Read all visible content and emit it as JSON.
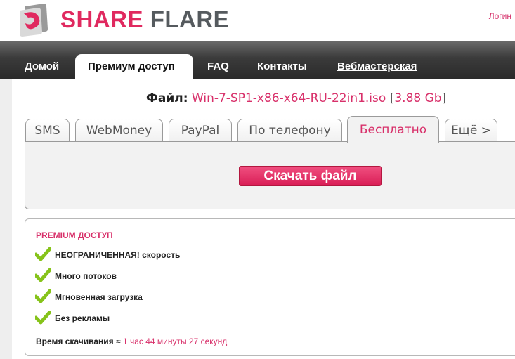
{
  "header": {
    "logo_share": "SHARE",
    "logo_flare": "FLARE",
    "login_label": "Логин"
  },
  "nav": {
    "items": [
      {
        "label": "Домой"
      },
      {
        "label": "Премиум доступ",
        "active": true
      },
      {
        "label": "FAQ"
      },
      {
        "label": "Контакты"
      },
      {
        "label": "Вебмастерская"
      }
    ]
  },
  "file": {
    "label": "Файл:",
    "name": "Win-7-SP1-x86-x64-RU-22in1.iso",
    "size": "3.88 Gb"
  },
  "payment_tabs": [
    {
      "label": "SMS"
    },
    {
      "label": "WebMoney"
    },
    {
      "label": "PayPal"
    },
    {
      "label": "По телефону"
    },
    {
      "label": "Бесплатно",
      "active": true
    },
    {
      "label": "Ещё >"
    }
  ],
  "download_button": "Скачать файл",
  "premium": {
    "title": "PREMIUM ДОСТУП",
    "features": [
      "НЕОГРАНИЧЕННАЯ! скорость",
      "Много потоков",
      "Мгновенная загрузка",
      "Без рекламы"
    ],
    "download_time_label": "Время скачивания",
    "approx_symbol": "≈",
    "download_time_value": "1 час 44 минуты 27 секунд"
  },
  "colors": {
    "accent": "#d8306a",
    "check": "#86c31a",
    "nav_bg": "#3b3b3b"
  },
  "icons": {
    "logo": "shareflare-logo-icon",
    "check": "check-icon"
  }
}
